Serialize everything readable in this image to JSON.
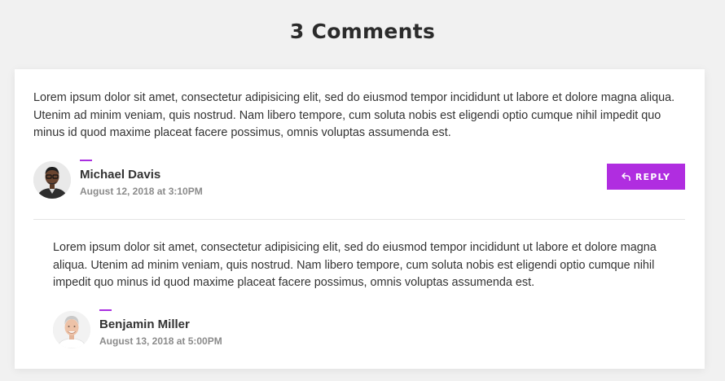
{
  "heading": "3 Comments",
  "comments": [
    {
      "text": "Lorem ipsum dolor sit amet, consectetur adipisicing elit, sed do eiusmod tempor incididunt ut labore et dolore magna aliqua. Utenim ad minim veniam, quis nostrud. Nam libero tempore, cum soluta nobis est eligendi optio cumque nihil impedit quo minus id quod maxime placeat facere possimus, omnis voluptas assumenda est.",
      "author": "Michael Davis",
      "date": "August 12, 2018 at 3:10PM",
      "reply_label": "REPLY",
      "reply_icon": "reply-arrow-icon"
    },
    {
      "text": "Lorem ipsum dolor sit amet, consectetur adipisicing elit, sed do eiusmod tempor incididunt ut labore et dolore magna aliqua. Utenim ad minim veniam, quis nostrud. Nam libero tempore, cum soluta nobis est eligendi optio cumque nihil impedit quo minus id quod maxime placeat facere possimus, omnis voluptas assumenda est.",
      "author": "Benjamin Miller",
      "date": "August 13, 2018 at 5:00PM"
    }
  ],
  "colors": {
    "accent": "#b02de0",
    "background": "#f1f1f1",
    "card": "#ffffff"
  }
}
